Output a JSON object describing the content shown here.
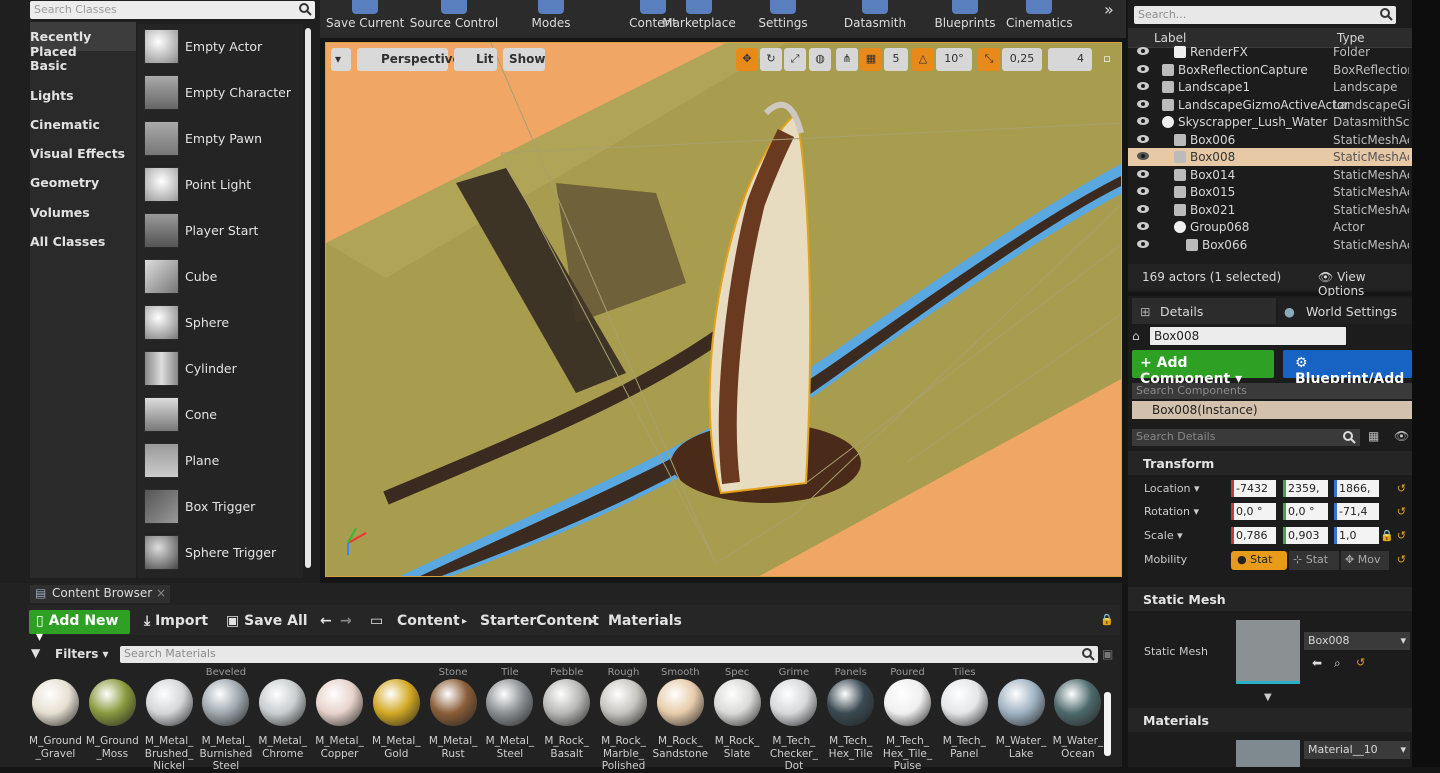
{
  "modes_panel": {
    "search_placeholder": "Search Classes",
    "categories": [
      "Recently Placed",
      "Basic",
      "Lights",
      "Cinematic",
      "Visual Effects",
      "Geometry",
      "Volumes",
      "All Classes"
    ],
    "actors": [
      "Empty Actor",
      "Empty Character",
      "Empty Pawn",
      "Point Light",
      "Player Start",
      "Cube",
      "Sphere",
      "Cylinder",
      "Cone",
      "Plane",
      "Box Trigger",
      "Sphere Trigger"
    ]
  },
  "toolbar": {
    "items": [
      "Save Current",
      "Source Control",
      "Modes",
      "Content",
      "Marketplace",
      "Settings",
      "Datasmith",
      "Blueprints",
      "Cinematics"
    ]
  },
  "viewport": {
    "options_label": "▾",
    "perspective_label": "Perspective",
    "lit_label": "Lit",
    "show_label": "Show",
    "grid_snap": "5",
    "rotation_snap": "10°",
    "scale_snap": "0,25",
    "camera_speed": "4"
  },
  "outliner": {
    "search_placeholder": "Search...",
    "col_label": "Label",
    "col_type": "Type",
    "rows": [
      {
        "name": "RenderFX",
        "type": "Folder",
        "indent": 2
      },
      {
        "name": "BoxReflectionCapture",
        "type": "BoxReflection",
        "indent": 1
      },
      {
        "name": "Landscape1",
        "type": "Landscape",
        "indent": 1
      },
      {
        "name": "LandscapeGizmoActiveActor",
        "type": "LandscapeGizmo",
        "indent": 1
      },
      {
        "name": "Skyscrapper_Lush_Water",
        "type": "DatasmithScene",
        "indent": 1
      },
      {
        "name": "Box006",
        "type": "StaticMeshActor",
        "indent": 2
      },
      {
        "name": "Box008",
        "type": "StaticMeshActor",
        "indent": 2
      },
      {
        "name": "Box014",
        "type": "StaticMeshActor",
        "indent": 2
      },
      {
        "name": "Box015",
        "type": "StaticMeshActor",
        "indent": 2
      },
      {
        "name": "Box021",
        "type": "StaticMeshActor",
        "indent": 2
      },
      {
        "name": "Group068",
        "type": "Actor",
        "indent": 2
      },
      {
        "name": "Box066",
        "type": "StaticMeshActor",
        "indent": 3
      }
    ],
    "selected_row": "Box008",
    "actor_count": "169 actors (1 selected)",
    "view_options": "View Options"
  },
  "details": {
    "tab_details": "Details",
    "tab_world": "World Settings",
    "name_value": "Box008",
    "add_component": "+ Add Component ▾",
    "blueprint_add": "Blueprint/Add",
    "search_components": "Search Components",
    "instance_label": "Box008(Instance)",
    "search_details": "Search Details",
    "transform_section": "Transform",
    "location_label": "Location ▾",
    "location": [
      "-7432",
      "2359,",
      "1866,"
    ],
    "rotation_label": "Rotation ▾",
    "rotation": [
      "0,0 °",
      "0,0 °",
      "-71,4"
    ],
    "scale_label": "Scale ▾",
    "scale": [
      "0,786",
      "0,903",
      "1,0"
    ],
    "mobility_label": "Mobility",
    "mobility": [
      "Stat",
      "Stat",
      "Mov"
    ],
    "static_mesh_section": "Static Mesh",
    "static_mesh_label": "Static Mesh",
    "static_mesh_value": "Box008",
    "materials_section": "Materials",
    "material_value": "Material__10"
  },
  "content_browser": {
    "tab_label": "Content Browser",
    "add_new": "Add New ▾",
    "import": "Import",
    "save_all": "Save All",
    "path": [
      "Content",
      "StarterContent",
      "Materials"
    ],
    "filters": "Filters ▾",
    "search_placeholder": "Search Materials",
    "materials": [
      {
        "top": "",
        "name": "M_Ground\n_Gravel",
        "color": "#e6e0d2"
      },
      {
        "top": "",
        "name": "M_Ground\n_Moss",
        "color": "#8a9a3e"
      },
      {
        "top": "",
        "name": "M_Metal_\nBrushed_\nNickel",
        "color": "#d4d6d8"
      },
      {
        "top": "Beveled",
        "name": "M_Metal_\nBurnished\nSteel",
        "color": "#a0a8ae"
      },
      {
        "top": "",
        "name": "M_Metal_\nChrome",
        "color": "#c9cdcf"
      },
      {
        "top": "",
        "name": "M_Metal_\nCopper",
        "color": "#e7d3cb"
      },
      {
        "top": "",
        "name": "M_Metal_\nGold",
        "color": "#d2a823"
      },
      {
        "top": "Stone",
        "name": "M_Metal_\nRust",
        "color": "#8a5e38"
      },
      {
        "top": "Tile",
        "name": "M_Metal_\nSteel",
        "color": "#8c9093"
      },
      {
        "top": "Pebble",
        "name": "M_Rock_\nBasalt",
        "color": "#b8b8b6"
      },
      {
        "top": "Rough",
        "name": "M_Rock_\nMarble_\nPolished",
        "color": "#c7c5c0"
      },
      {
        "top": "Smooth",
        "name": "M_Rock_\nSandstone",
        "color": "#e7ccaa"
      },
      {
        "top": "Spec",
        "name": "M_Rock_\nSlate",
        "color": "#d9dad8"
      },
      {
        "top": "Grime",
        "name": "M_Tech_\nChecker_\nDot",
        "color": "#d6d8da"
      },
      {
        "top": "Panels",
        "name": "M_Tech_\nHex_Tile",
        "color": "#3a4a52"
      },
      {
        "top": "Poured",
        "name": "M_Tech_\nHex_Tile_\nPulse",
        "color": "#f0f0f0"
      },
      {
        "top": "Tiles",
        "name": "M_Tech_\nPanel",
        "color": "#e4e6e8"
      },
      {
        "top": "",
        "name": "M_Water_\nLake",
        "color": "#9fb3c3"
      },
      {
        "top": "",
        "name": "M_Water_\nOcean",
        "color": "#4e6a6c"
      }
    ]
  }
}
